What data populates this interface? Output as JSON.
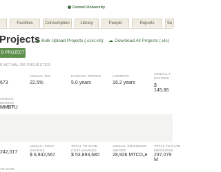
{
  "header": {
    "brand": "Cornell University"
  },
  "tabs": [
    "Facilities",
    "Consumption",
    "Library",
    "People",
    "Reports",
    "Se"
  ],
  "page": {
    "title": "Projects",
    "bulk_upload": "Bulk Upload Projects (.csv/.xls)",
    "download_all": "Download All Projects (.xls)",
    "add_button": "D PROJECT",
    "section_label": "S ACTUAL OR PROJECTED"
  },
  "metrics_row1": [
    {
      "label": "",
      "value": "673"
    },
    {
      "label": "ANNUAL ROI",
      "value": "22.5%"
    },
    {
      "label": "PAYBACK PERIOD",
      "value": "5.0 years"
    },
    {
      "label": "LIFESPAN",
      "value": "16.2 years"
    },
    {
      "label": "ANNUAL F SAVINGS",
      "value": "$ 145,86"
    }
  ],
  "metrics_row2": [
    {
      "label": "ANNUAL ENERGY SAVINGS",
      "value": "MMBTU"
    }
  ],
  "metrics_row3": [
    {
      "label": "",
      "value": "242,017"
    },
    {
      "label": "ANNUAL COST SAVINGS",
      "value": "$ 6,942,567"
    },
    {
      "label": "TOTAL TO DATE COST SAVINGS",
      "value": "$ 53,893,680"
    },
    {
      "label": "ANNUAL EMISSIONS ABATED",
      "value": "28,926 MTCO₂e"
    },
    {
      "label": "TOTAL TO DATE EMISSIONS",
      "value": "237,079 M"
    }
  ],
  "footer_label": "TO DATE"
}
